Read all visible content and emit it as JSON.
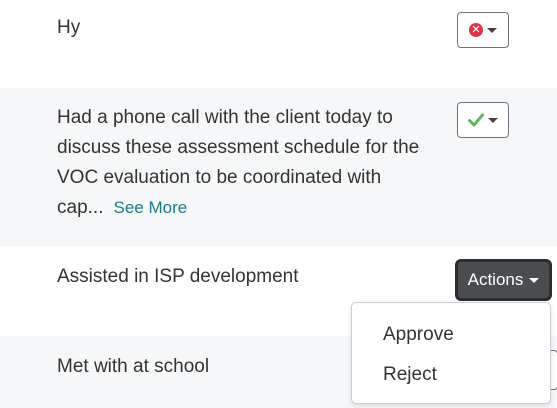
{
  "notes": [
    {
      "text": "Hy",
      "status_icon": "x-circle-icon",
      "status_color": "#d9364a"
    },
    {
      "text_lines": [
        "Had a phone call with the client today to",
        "discuss these assessment schedule for the",
        "VOC evaluation to be coordinated with",
        "cap..."
      ],
      "see_more_label": "See More",
      "status_icon": "checkmark-icon",
      "status_color": "#5cb85c"
    },
    {
      "text": "Assisted in ISP development",
      "actions_label": "Actions"
    },
    {
      "text": "Met with at school"
    }
  ],
  "actions_menu": {
    "items": [
      "Approve",
      "Reject"
    ]
  },
  "colors": {
    "alt_row_bg": "#f5f7f8",
    "link": "#1a7a8a",
    "actions_bg": "#4a4d50"
  }
}
